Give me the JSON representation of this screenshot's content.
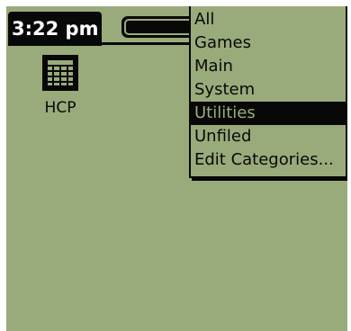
{
  "status_bar": {
    "time": "3:22 pm"
  },
  "category_popup": {
    "trigger_icon": "category-trigger-button",
    "items": [
      {
        "label": "All",
        "selected": false
      },
      {
        "label": "Games",
        "selected": false
      },
      {
        "label": "Main",
        "selected": false
      },
      {
        "label": "System",
        "selected": false
      },
      {
        "label": "Utilities",
        "selected": true
      },
      {
        "label": "Unfiled",
        "selected": false
      },
      {
        "label": "Edit Categories...",
        "selected": false
      }
    ]
  },
  "apps": [
    {
      "label": "HCP",
      "icon": "calculator-grid-icon"
    }
  ],
  "colors": {
    "screen_bg": "#9aab7b",
    "ink": "#080808",
    "page_bg": "#ffffff"
  }
}
